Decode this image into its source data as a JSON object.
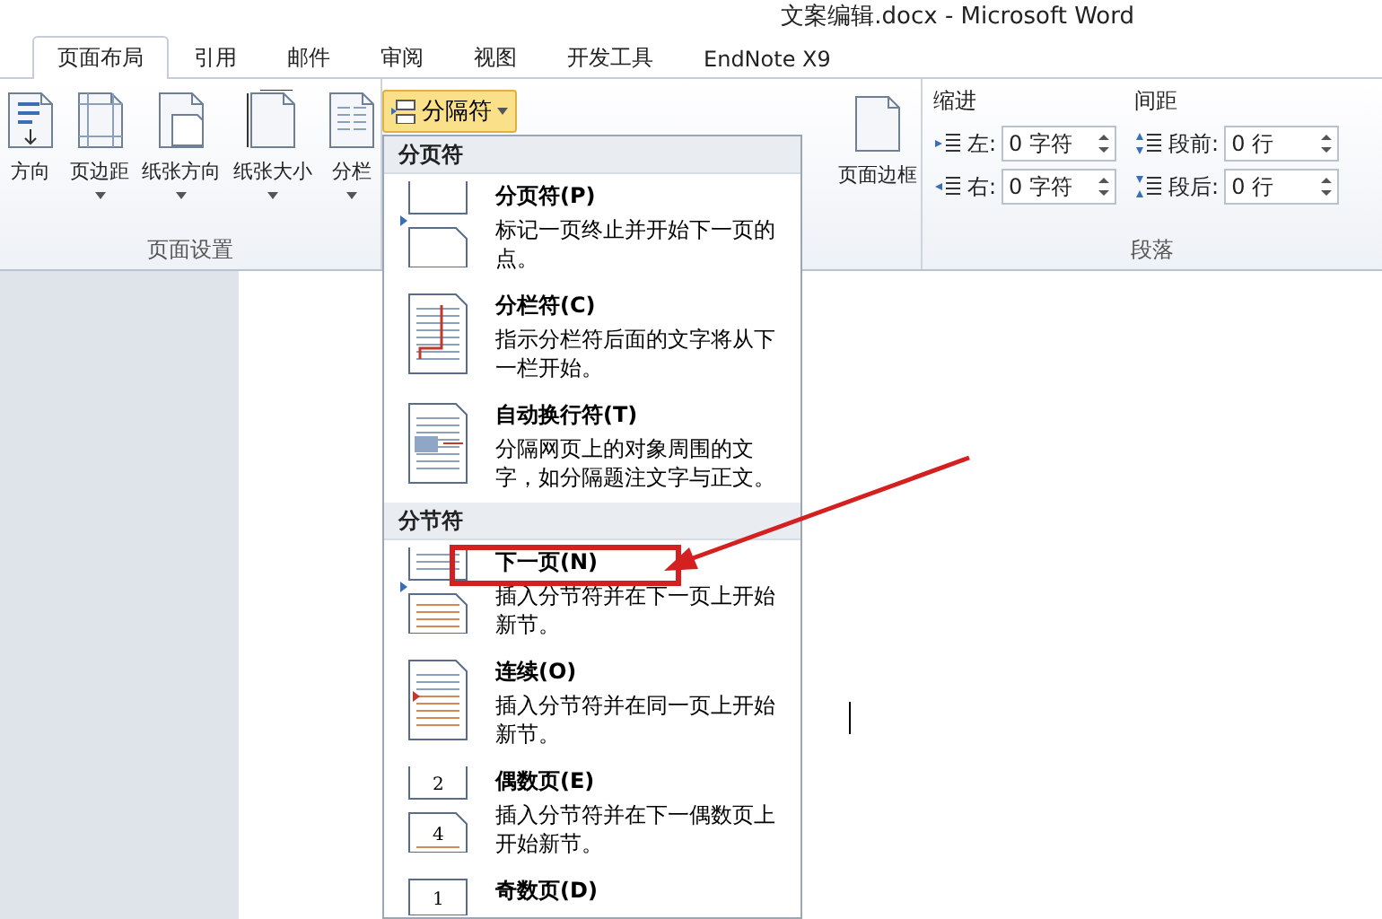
{
  "window": {
    "title": "文案编辑.docx - Microsoft Word"
  },
  "tabs": [
    {
      "label": "页面布局",
      "selected": true
    },
    {
      "label": "引用",
      "selected": false
    },
    {
      "label": "邮件",
      "selected": false
    },
    {
      "label": "审阅",
      "selected": false
    },
    {
      "label": "视图",
      "selected": false
    },
    {
      "label": "开发工具",
      "selected": false
    },
    {
      "label": "EndNote X9",
      "selected": false
    }
  ],
  "page_setup": {
    "label": "页面设置",
    "buttons": [
      {
        "label": "方向",
        "kind": "orientation",
        "dropdown": false
      },
      {
        "label": "页边距",
        "kind": "margins",
        "dropdown": true
      },
      {
        "label": "纸张方向",
        "kind": "paper-orientation",
        "dropdown": true
      },
      {
        "label": "纸张大小",
        "kind": "paper-size",
        "dropdown": true
      },
      {
        "label": "分栏",
        "kind": "columns",
        "dropdown": true
      }
    ]
  },
  "breaks_button": {
    "label": "分隔符",
    "expanded": true
  },
  "page_border_button": {
    "label": "页面边框"
  },
  "paragraph": {
    "label": "段落",
    "indent_label": "缩进",
    "spacing_label": "间距",
    "indent": [
      {
        "label": "左:",
        "value": "0 字符",
        "kind": "left"
      },
      {
        "label": "右:",
        "value": "0 字符",
        "kind": "right"
      }
    ],
    "spacing": [
      {
        "label": "段前:",
        "value": "0 行",
        "kind": "before"
      },
      {
        "label": "段后:",
        "value": "0 行",
        "kind": "after"
      }
    ]
  },
  "menu": {
    "sections": [
      {
        "title": "分页符",
        "items": [
          {
            "title": "分页符(P)",
            "description": "标记一页终止并开始下一页的点。",
            "kind": "page-break"
          },
          {
            "title": "分栏符(C)",
            "description": "指示分栏符后面的文字将从下一栏开始。",
            "kind": "column-break"
          },
          {
            "title": "自动换行符(T)",
            "description": "分隔网页上的对象周围的文字，如分隔题注文字与正文。",
            "kind": "text-wrap"
          }
        ]
      },
      {
        "title": "分节符",
        "items": [
          {
            "title": "下一页(N)",
            "description": "插入分节符并在下一页上开始新节。",
            "kind": "next-page"
          },
          {
            "title": "连续(O)",
            "description": "插入分节符并在同一页上开始新节。",
            "kind": "continuous"
          },
          {
            "title": "偶数页(E)",
            "description": "插入分节符并在下一偶数页上开始新节。",
            "kind": "even-page",
            "page_numbers": [
              "2",
              "4"
            ]
          },
          {
            "title": "奇数页(D)",
            "kind": "odd-page",
            "page_numbers": [
              "1"
            ]
          }
        ]
      }
    ]
  }
}
